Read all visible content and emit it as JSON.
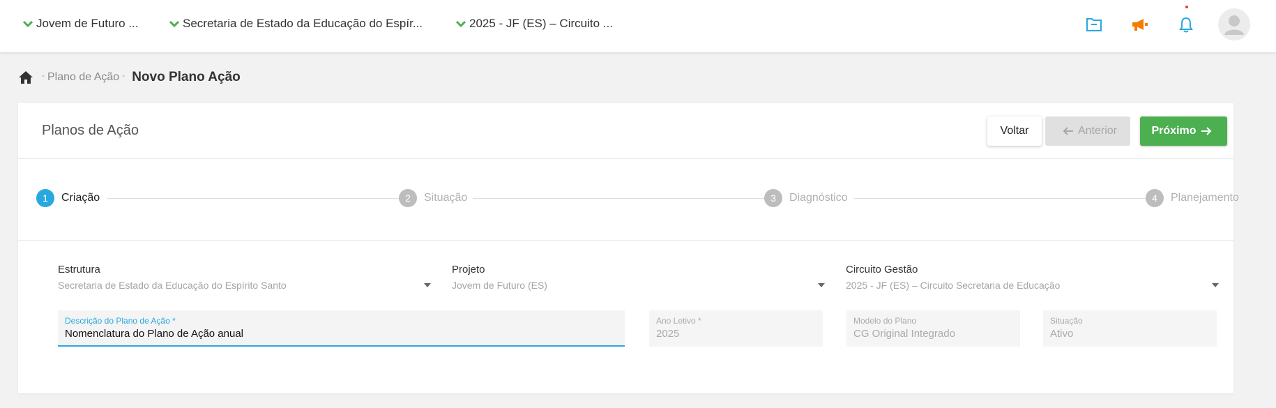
{
  "topbar": {
    "contexts": [
      {
        "label": "Jovem de Futuro ..."
      },
      {
        "label": "Secretaria de Estado da Educação do Espír..."
      },
      {
        "label": "2025 - JF (ES) – Circuito ..."
      }
    ]
  },
  "breadcrumb": {
    "link": "Plano de Ação",
    "current": "Novo Plano Ação"
  },
  "card": {
    "title": "Planos de Ação",
    "buttons": {
      "back": "Voltar",
      "previous": "Anterior",
      "next": "Próximo"
    }
  },
  "stepper": [
    {
      "number": "1",
      "label": "Criação",
      "state": "active"
    },
    {
      "number": "2",
      "label": "Situação",
      "state": "inactive"
    },
    {
      "number": "3",
      "label": "Diagnóstico",
      "state": "inactive"
    },
    {
      "number": "4",
      "label": "Planejamento",
      "state": "inactive"
    }
  ],
  "selects": {
    "estrutura": {
      "label": "Estrutura",
      "value": "Secretaria de Estado da Educação do Espírito Santo"
    },
    "projeto": {
      "label": "Projeto",
      "value": "Jovem de Futuro (ES)"
    },
    "circuito": {
      "label": "Circuito Gestão",
      "value": "2025 - JF (ES) – Circuito Secretaria de Educação"
    }
  },
  "fields": {
    "descricao": {
      "label": "Descrição do Plano de Ação *",
      "value": "Nomenclatura do Plano de Ação anual"
    },
    "ano": {
      "label": "Ano Letivo *",
      "value": "2025"
    },
    "modelo": {
      "label": "Modelo do Plano",
      "value": "CG Original Integrado"
    },
    "situacao": {
      "label": "Situação",
      "value": "Ativo"
    }
  },
  "colors": {
    "accent": "#29a8e0",
    "success": "#4caf50",
    "context_chevron": "#4caf50",
    "folder_icon": "#29a8e0",
    "megaphone_icon": "#f57c00",
    "bell_icon": "#29a8e0",
    "notification_dot": "#e53935"
  },
  "icons": [
    "chevron-down-icon",
    "folder-icon",
    "megaphone-icon",
    "bell-icon",
    "user-avatar-icon",
    "home-icon",
    "arrow-left-icon",
    "arrow-right-icon"
  ]
}
